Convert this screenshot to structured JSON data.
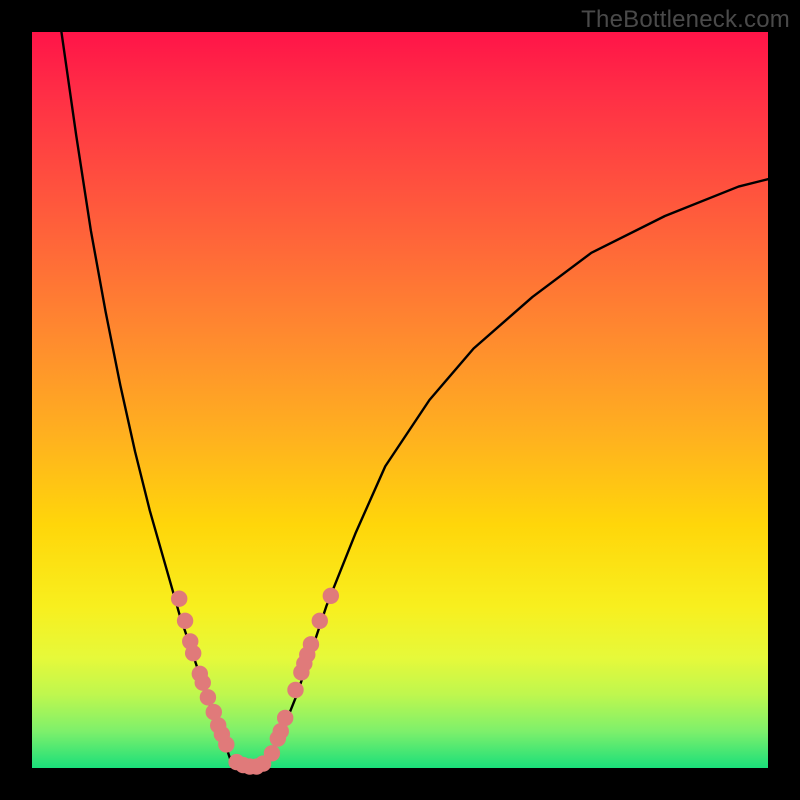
{
  "watermark": "TheBottleneck.com",
  "colors": {
    "curve_stroke": "#000000",
    "dot_fill": "#e07a7a",
    "dot_stroke": "#c96b6b"
  },
  "chart_data": {
    "type": "line",
    "title": "",
    "xlabel": "",
    "ylabel": "",
    "xlim": [
      0,
      100
    ],
    "ylim": [
      0,
      100
    ],
    "series": [
      {
        "name": "left-branch",
        "x": [
          4,
          6,
          8,
          10,
          12,
          14,
          16,
          18,
          20,
          22,
          24,
          26,
          27
        ],
        "y": [
          100,
          86,
          73,
          62,
          52,
          43,
          35,
          28,
          21,
          15,
          9,
          4,
          1
        ]
      },
      {
        "name": "right-branch",
        "x": [
          32,
          34,
          36,
          38,
          40,
          44,
          48,
          54,
          60,
          68,
          76,
          86,
          96,
          100
        ],
        "y": [
          1,
          5,
          10,
          16,
          22,
          32,
          41,
          50,
          57,
          64,
          70,
          75,
          79,
          80
        ]
      },
      {
        "name": "valley-floor",
        "x": [
          27,
          28,
          29,
          30,
          31,
          32
        ],
        "y": [
          1,
          0.4,
          0.2,
          0.2,
          0.4,
          1
        ]
      }
    ],
    "dots": {
      "name": "highlighted-points",
      "points": [
        {
          "x": 20.0,
          "y": 23.0
        },
        {
          "x": 20.8,
          "y": 20.0
        },
        {
          "x": 21.5,
          "y": 17.2
        },
        {
          "x": 21.9,
          "y": 15.6
        },
        {
          "x": 22.8,
          "y": 12.8
        },
        {
          "x": 23.2,
          "y": 11.6
        },
        {
          "x": 23.9,
          "y": 9.6
        },
        {
          "x": 24.7,
          "y": 7.6
        },
        {
          "x": 25.3,
          "y": 5.8
        },
        {
          "x": 25.8,
          "y": 4.6
        },
        {
          "x": 26.4,
          "y": 3.2
        },
        {
          "x": 27.8,
          "y": 0.8
        },
        {
          "x": 28.7,
          "y": 0.4
        },
        {
          "x": 29.6,
          "y": 0.2
        },
        {
          "x": 30.5,
          "y": 0.2
        },
        {
          "x": 31.4,
          "y": 0.6
        },
        {
          "x": 32.6,
          "y": 2.0
        },
        {
          "x": 33.4,
          "y": 4.0
        },
        {
          "x": 33.8,
          "y": 5.0
        },
        {
          "x": 34.4,
          "y": 6.8
        },
        {
          "x": 35.8,
          "y": 10.6
        },
        {
          "x": 36.6,
          "y": 13.0
        },
        {
          "x": 37.0,
          "y": 14.2
        },
        {
          "x": 37.4,
          "y": 15.4
        },
        {
          "x": 37.9,
          "y": 16.8
        },
        {
          "x": 39.1,
          "y": 20.0
        },
        {
          "x": 40.6,
          "y": 23.4
        }
      ]
    }
  }
}
